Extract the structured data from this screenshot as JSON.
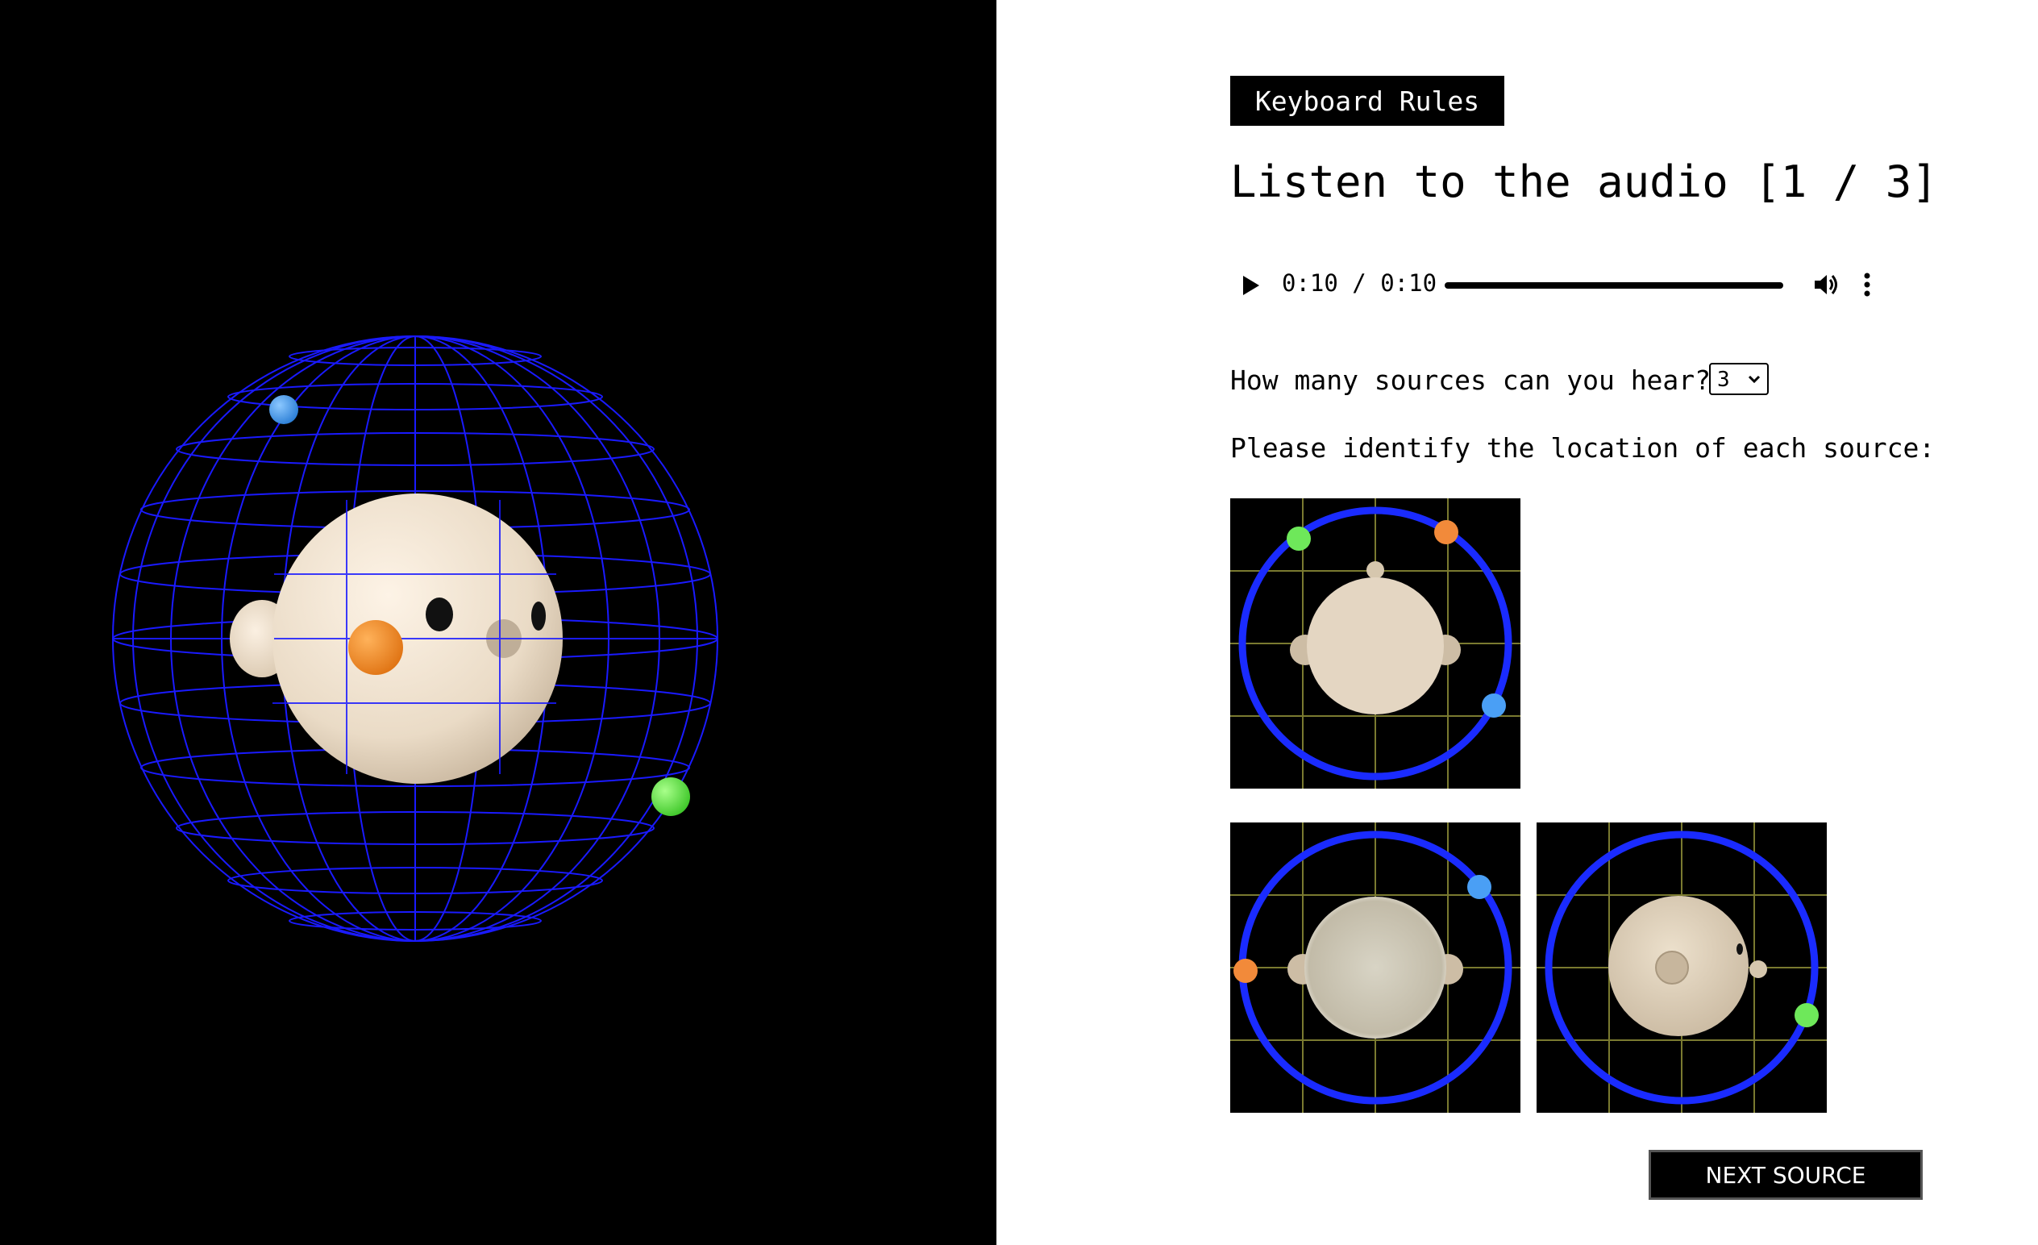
{
  "scene": {
    "sources": [
      {
        "name": "blue-source",
        "color": "#4a9ff5"
      },
      {
        "name": "orange-source",
        "color": "#f28a3a"
      },
      {
        "name": "green-source",
        "color": "#6ee85a"
      }
    ],
    "colors": {
      "background": "#000000",
      "wireframe": "#1a1aff",
      "head": "#f2e2cf"
    }
  },
  "panel": {
    "keyboard_rules_label": "Keyboard Rules",
    "title": "Listen to the audio [1 / 3]",
    "audio": {
      "time": "0:10 / 0:10",
      "icons": [
        "play-icon",
        "volume-icon",
        "more-options-icon"
      ]
    },
    "question": "How many sources can you hear?",
    "source_count": "3",
    "instruction": "Please identify the location of each source:",
    "locators": [
      {
        "view": "top",
        "markers": [
          "green",
          "orange",
          "blue"
        ]
      },
      {
        "view": "front",
        "markers": [
          "blue",
          "orange"
        ]
      },
      {
        "view": "side",
        "markers": [
          "green"
        ]
      }
    ],
    "next_label": "NEXT SOURCE"
  }
}
